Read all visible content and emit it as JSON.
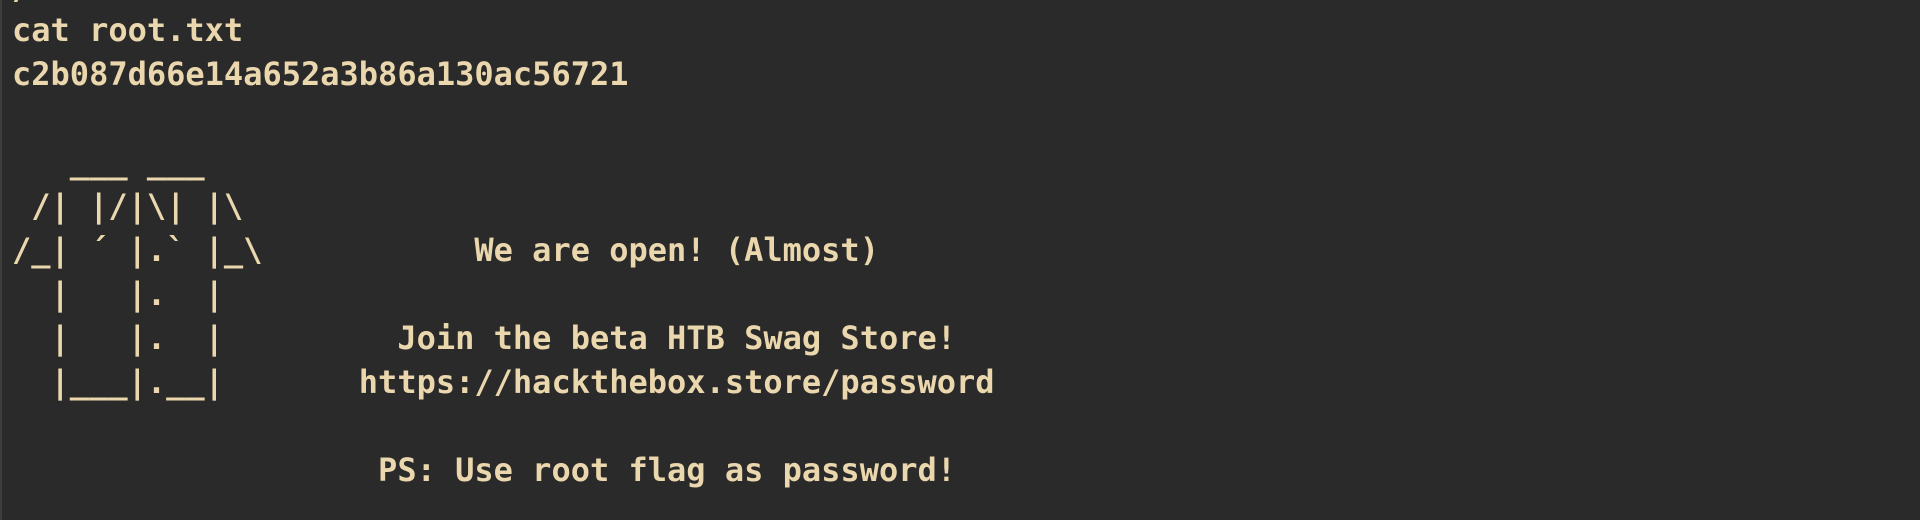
{
  "terminal": {
    "prompt_remnant": "/",
    "command": "cat root.txt",
    "flag_output": "c2b087d66e14a652a3b86a130ac56721",
    "banner": [
      "   ___ ___",
      " /| |/|\\| |\\",
      "/_| ´ |.` |_\\           We are open! (Almost)",
      "  |   |.  |",
      "  |   |.  |         Join the beta HTB Swag Store!",
      "  |___|.__|       https://hackthebox.store/password",
      "",
      "                   PS: Use root flag as password!"
    ]
  },
  "colors": {
    "background": "#2a2a2a",
    "text": "#ebd7ad"
  }
}
